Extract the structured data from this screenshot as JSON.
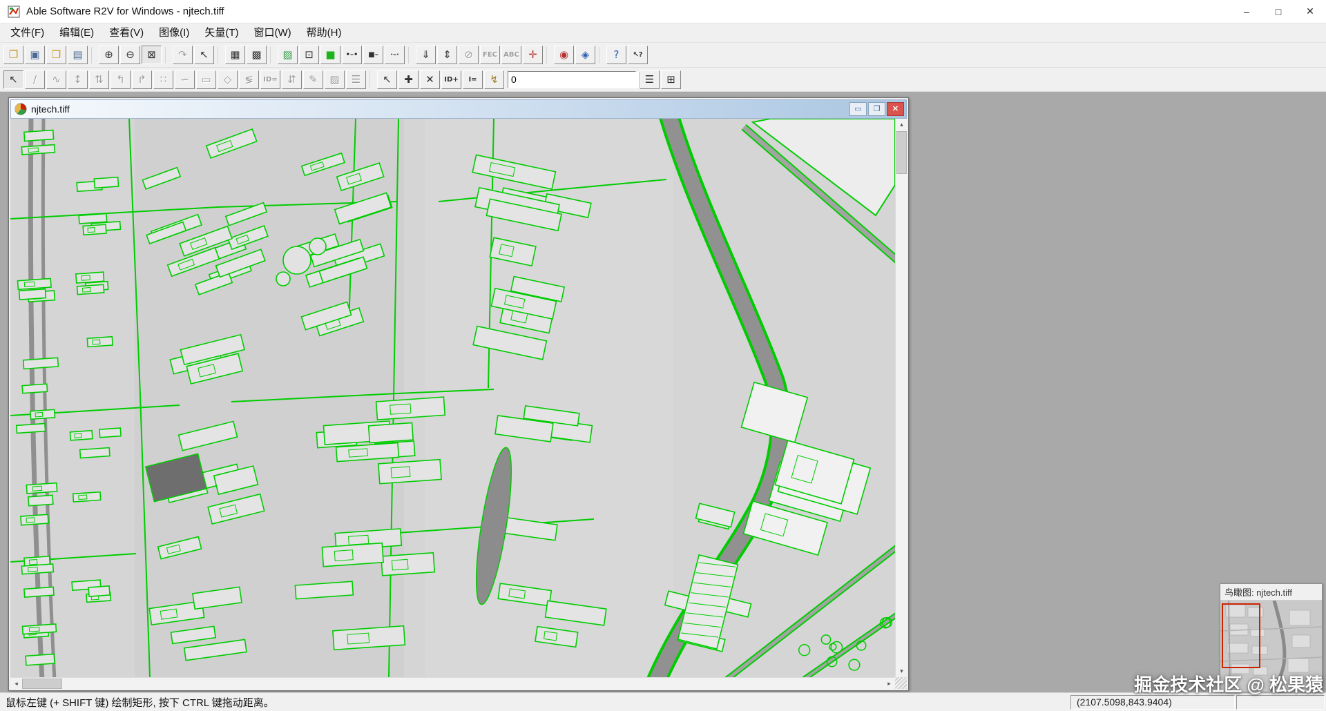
{
  "colors": {
    "vector_green": "#00cc00",
    "raster_bg": "#d5d5d5",
    "view_rect_red": "#cc2200",
    "close_red": "#d9534f"
  },
  "titlebar": {
    "title": "Able Software R2V for Windows - njtech.tiff",
    "minimize": "–",
    "maximize": "□",
    "close": "✕"
  },
  "menubar": {
    "items": [
      {
        "id": "file",
        "label": "文件(F)"
      },
      {
        "id": "edit",
        "label": "编辑(E)"
      },
      {
        "id": "view",
        "label": "查看(V)"
      },
      {
        "id": "image",
        "label": "图像(I)"
      },
      {
        "id": "vector",
        "label": "矢量(T)"
      },
      {
        "id": "window",
        "label": "窗口(W)"
      },
      {
        "id": "help",
        "label": "帮助(H)"
      }
    ]
  },
  "toolbar_main": {
    "buttons": [
      {
        "name": "open-file",
        "glyph": "❐",
        "color": "#c89623"
      },
      {
        "name": "save-file",
        "glyph": "▣",
        "color": "#4a6a94"
      },
      {
        "name": "open-project",
        "glyph": "❒",
        "color": "#c89623"
      },
      {
        "name": "save-project",
        "glyph": "▤",
        "color": "#4a6a94"
      },
      {
        "sep": true
      },
      {
        "name": "zoom-in",
        "glyph": "⊕"
      },
      {
        "name": "zoom-out",
        "glyph": "⊖"
      },
      {
        "name": "zoom-select",
        "glyph": "⊠",
        "pressed": true
      },
      {
        "sep": true
      },
      {
        "name": "undo",
        "glyph": "↷",
        "disabled": true
      },
      {
        "name": "select-pointer",
        "glyph": "↖"
      },
      {
        "sep": true
      },
      {
        "name": "image-window",
        "glyph": "▦"
      },
      {
        "name": "image-detail",
        "glyph": "▩"
      },
      {
        "sep": true
      },
      {
        "name": "color-classify",
        "glyph": "▨",
        "color": "#2f9e44"
      },
      {
        "name": "image-frame",
        "glyph": "⊡"
      },
      {
        "name": "vector-overlay",
        "glyph": "■",
        "color": "#1db31d"
      },
      {
        "name": "line-endpoints",
        "text": "•–•"
      },
      {
        "name": "line-segment",
        "text": "■–"
      },
      {
        "name": "line-points",
        "text": "·–·"
      },
      {
        "sep": true
      },
      {
        "name": "id-down",
        "glyph": "⇓"
      },
      {
        "name": "id-updown",
        "glyph": "⇕"
      },
      {
        "name": "erase-mode",
        "glyph": "⊘",
        "disabled": true
      },
      {
        "name": "ocr-fec",
        "text": "FEC",
        "disabled": true
      },
      {
        "name": "ocr-abc",
        "text": "ABC",
        "disabled": true
      },
      {
        "name": "move-crosshair",
        "glyph": "✛",
        "color": "#b83232"
      },
      {
        "sep": true
      },
      {
        "name": "control-point-red",
        "glyph": "◉",
        "color": "#b83232"
      },
      {
        "name": "control-point-blue",
        "glyph": "◈",
        "color": "#2b5fb3"
      },
      {
        "sep": true
      },
      {
        "name": "help",
        "glyph": "?",
        "color": "#2b5fb3"
      },
      {
        "name": "context-help",
        "text": "↖?"
      }
    ]
  },
  "toolbar_vector": {
    "buttons_left": [
      {
        "name": "vector-select",
        "glyph": "↖",
        "pressed": true
      },
      {
        "name": "draw-line",
        "glyph": "∕",
        "disabled": true
      },
      {
        "name": "draw-curve",
        "glyph": "∿",
        "disabled": true
      },
      {
        "name": "move-node",
        "glyph": "↕",
        "disabled": true
      },
      {
        "name": "insert-node",
        "glyph": "⇅",
        "disabled": true
      },
      {
        "name": "corner-left",
        "glyph": "↰",
        "disabled": true
      },
      {
        "name": "corner-right",
        "glyph": "↱",
        "disabled": true
      },
      {
        "name": "join-lines",
        "glyph": "∷",
        "disabled": true
      },
      {
        "name": "smooth-line",
        "glyph": "∽",
        "disabled": true
      },
      {
        "name": "draw-rectangle",
        "glyph": "▭",
        "disabled": true
      },
      {
        "name": "draw-polygon",
        "glyph": "◇",
        "disabled": true
      },
      {
        "name": "reverse-line",
        "glyph": "≶",
        "disabled": true
      },
      {
        "name": "line-id",
        "text": "ID=",
        "disabled": true
      },
      {
        "name": "id-range",
        "glyph": "⇵",
        "disabled": true
      },
      {
        "name": "edit-pen",
        "glyph": "✎",
        "disabled": true
      },
      {
        "name": "fill-hatch",
        "glyph": "▨",
        "disabled": true
      },
      {
        "name": "contour-list",
        "glyph": "☰",
        "disabled": true
      },
      {
        "sep": true
      },
      {
        "name": "node-pick",
        "glyph": "↖"
      },
      {
        "name": "add-node",
        "glyph": "✚"
      },
      {
        "name": "delete-node",
        "glyph": "✕"
      },
      {
        "name": "assign-id",
        "text": "ID+"
      },
      {
        "name": "show-id",
        "text": "I="
      },
      {
        "name": "snap-tool",
        "glyph": "↯",
        "color": "#a07a1e"
      }
    ],
    "layer_combo": {
      "value": "0"
    },
    "buttons_right": [
      {
        "name": "line-list",
        "glyph": "☰"
      },
      {
        "name": "node-grid",
        "glyph": "⊞"
      }
    ]
  },
  "document_window": {
    "title": "njtech.tiff",
    "minimize": "▭",
    "maximize": "❐",
    "close": "✕"
  },
  "scrollbars": {
    "up": "▴",
    "down": "▾",
    "left": "◂",
    "right": "▸"
  },
  "overview_window": {
    "title": "鸟瞰图: njtech.tiff"
  },
  "statusbar": {
    "message": "鼠标左键 (+ SHIFT 键) 绘制矩形, 按下 CTRL 键拖动距离。",
    "coordinates": "(2107.5098,843.9404)"
  },
  "watermark": "掘金技术社区 @ 松果猿"
}
